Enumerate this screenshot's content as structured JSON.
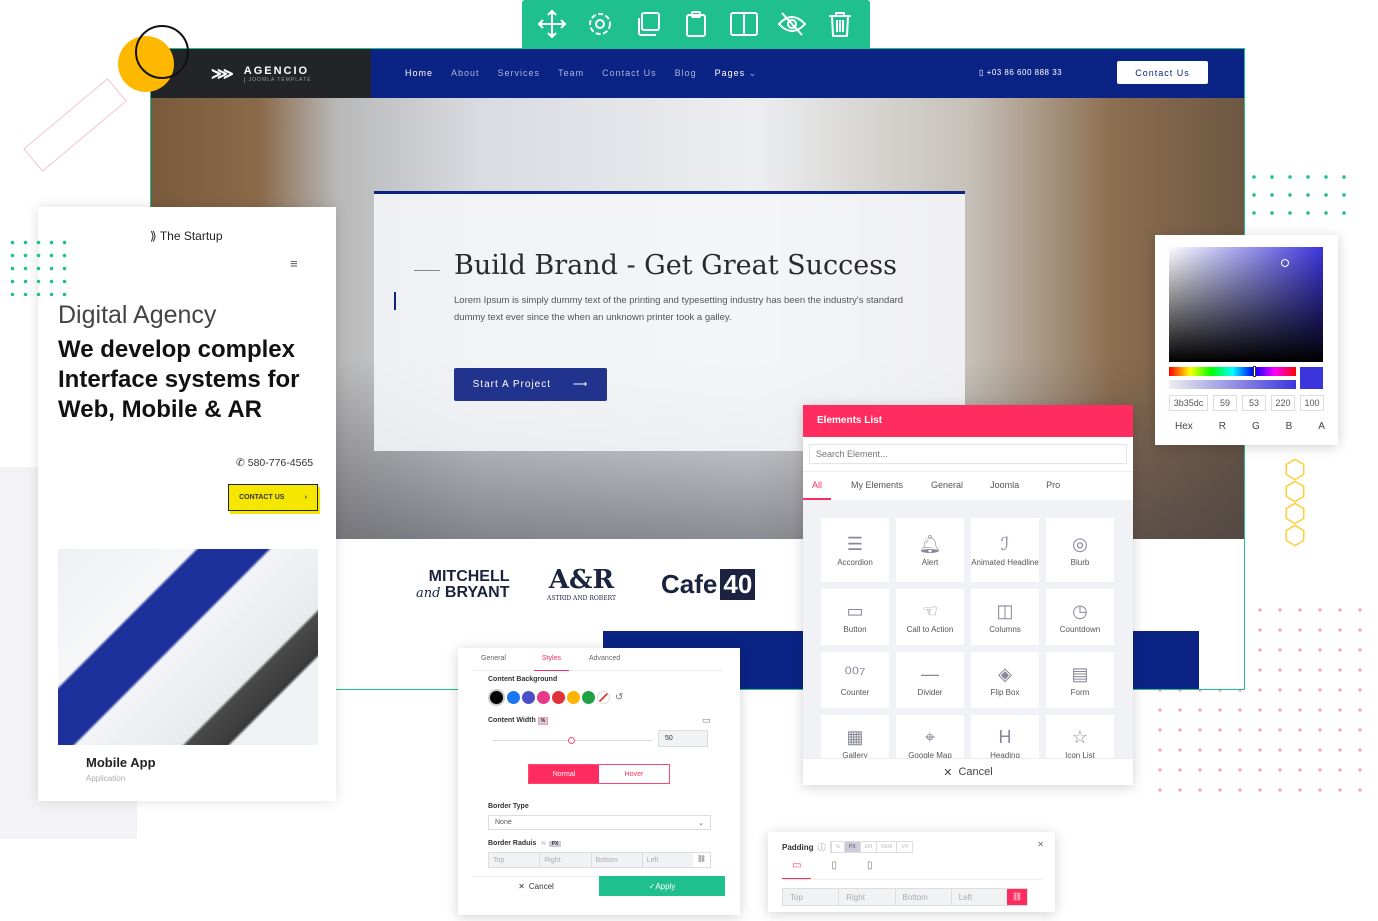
{
  "toolbar": {
    "icons": [
      "move-icon",
      "gear-icon",
      "duplicate-icon",
      "clipboard-icon",
      "columns-icon",
      "hide-icon",
      "trash-icon"
    ]
  },
  "site": {
    "logo": {
      "name": "AGENCIO",
      "tagline": "JOOMLA TEMPLATE"
    },
    "nav": [
      "Home",
      "About",
      "Services",
      "Team",
      "Contact Us",
      "Blog",
      "Pages"
    ],
    "phone": "+03 86 600 888 33",
    "cta": "Contact Us",
    "hero": {
      "title": "Build Brand - Get Great Success",
      "text": "Lorem Ipsum is simply dummy text of the printing and typesetting industry  has been the industry's standard dummy text ever since the when an unknown printer took a galley.",
      "button": "Start A Project"
    },
    "clients": {
      "mitchell_top": "MITCHELL",
      "mitchell_and": "and",
      "mitchell_bottom": "BRYANT",
      "ar": "A&R",
      "ar_sub": "ASTRID AND ROBERT",
      "cafe": "Cafe",
      "cafe_num": "40"
    }
  },
  "mobile": {
    "brand": "The Startup",
    "kicker": "Digital Agency",
    "headline": "We develop complex Interface systems for Web, Mobile & AR",
    "phone": "580-776-4565",
    "cta": "CONTACT US",
    "card_title": "Mobile App",
    "card_sub": "Application"
  },
  "elements": {
    "title": "Elements List",
    "search_placeholder": "Search Element...",
    "tabs": [
      "All",
      "My Elements",
      "General",
      "Joomla",
      "Pro"
    ],
    "active_tab": "All",
    "items": [
      {
        "label": "Accordion",
        "icon": "accordion-icon"
      },
      {
        "label": "Alert",
        "icon": "bell-icon"
      },
      {
        "label": "Animated Headline",
        "icon": "animated-headline-icon"
      },
      {
        "label": "Blurb",
        "icon": "blurb-icon"
      },
      {
        "label": "Button",
        "icon": "button-icon"
      },
      {
        "label": "Call to Action",
        "icon": "pointer-icon"
      },
      {
        "label": "Columns",
        "icon": "columns-icon"
      },
      {
        "label": "Countdown",
        "icon": "stopwatch-icon"
      },
      {
        "label": "Counter",
        "icon": "counter-icon"
      },
      {
        "label": "Divider",
        "icon": "divider-icon"
      },
      {
        "label": "Flip Box",
        "icon": "flip-box-icon"
      },
      {
        "label": "Form",
        "icon": "form-icon"
      },
      {
        "label": "Gallery",
        "icon": "gallery-icon"
      },
      {
        "label": "Google Map",
        "icon": "map-icon"
      },
      {
        "label": "Heading",
        "icon": "heading-icon"
      },
      {
        "label": "Icon List",
        "icon": "icon-list-icon"
      }
    ],
    "cancel": "Cancel"
  },
  "color_picker": {
    "hex": "3b35dc",
    "r": "59",
    "g": "53",
    "b": "220",
    "a": "100",
    "labels": [
      "Hex",
      "R",
      "G",
      "B",
      "A"
    ],
    "color": "#3b35dc"
  },
  "styles": {
    "tabs": [
      "General",
      "Styles",
      "Advanced"
    ],
    "active_tab": "Styles",
    "bg_label": "Content Background",
    "swatches": [
      "#000000",
      "#1877f2",
      "#4a4fc8",
      "#e8388a",
      "#e0323a",
      "#ffb400",
      "#22a045"
    ],
    "width_label": "Content Width",
    "width_unit": "%",
    "width_value": "50",
    "width_percent": 50,
    "states": [
      "Normal",
      "Hover"
    ],
    "border_type_label": "Border Type",
    "border_type": "None",
    "radius_label": "Border Raduis",
    "radius_units": [
      "%",
      "PX"
    ],
    "radius_fields": [
      "Top",
      "Right",
      "Bottom",
      "Left"
    ],
    "cancel": "Cancel",
    "apply": "Apply"
  },
  "padding": {
    "label": "Padding",
    "units": [
      "%",
      "PX",
      "EM",
      "REM",
      "VH"
    ],
    "active_unit": "PX",
    "fields": [
      "Top",
      "Right",
      "Bottom",
      "Left"
    ]
  },
  "colors": {
    "accent": "#ff2d5f",
    "green": "#1fc08e",
    "navy": "#0b2385"
  }
}
